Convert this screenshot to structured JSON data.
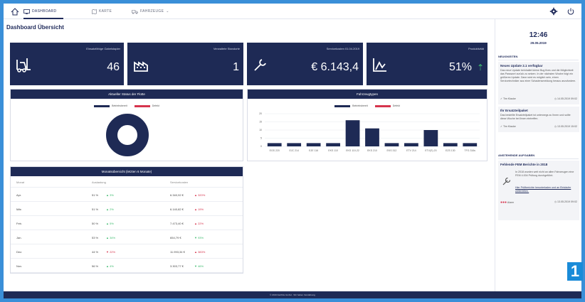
{
  "nav": {
    "dashboard": "DASHBOARD",
    "karte": "KARTE",
    "fahrzeuge": "FAHRZEUGE"
  },
  "page_title": "Dashboard Übersicht",
  "kpis": [
    {
      "label": "Einsatzfähige Gabelstapler",
      "value": "46",
      "icon": "forklift-icon"
    },
    {
      "label": "Verwaltete Standorte",
      "value": "1",
      "icon": "factory-icon"
    },
    {
      "label": "Servicekosten 01.04.2019",
      "value": "€ 6.143,4",
      "icon": "wrench-icon"
    },
    {
      "label": "Produktivität",
      "value": "51%",
      "icon": "chart-icon"
    }
  ],
  "fleet_status": {
    "title": "Aktueller Status der Flotte",
    "legend": [
      "Betriebsbereit",
      "Defekt"
    ],
    "colors": {
      "ok": "#1e2a55",
      "defect": "#d6344d"
    }
  },
  "vehicles": {
    "title": "Fahrzeugtypen",
    "legend": [
      "Betriebsbereit",
      "Defekt"
    ],
    "ytick_labels": [
      "20",
      "15",
      "10",
      "5",
      "0"
    ]
  },
  "chart_data": {
    "type": "bar",
    "categories": [
      "EGS 220",
      "EJC 214",
      "EJE 116",
      "EKS 110",
      "EKS 110-22",
      "EKS 210",
      "EKS 312",
      "ETV 214",
      "ETV(S) 20",
      "EZS 130",
      "TFG 316s"
    ],
    "series": [
      {
        "name": "Betriebsbereit",
        "values": [
          2,
          2,
          2,
          2,
          16,
          11,
          2,
          2,
          10,
          2,
          2
        ]
      },
      {
        "name": "Defekt",
        "values": [
          0,
          0,
          0,
          0,
          0,
          0,
          0,
          0,
          0,
          0,
          0
        ]
      }
    ],
    "ylim": [
      0,
      20
    ]
  },
  "monthly": {
    "title": "Monatsübersicht (letzten 6 Monate)",
    "headers": [
      "Monat",
      "Auslastung",
      "Servicekosten"
    ],
    "rows": [
      {
        "month": "Apr.",
        "load": "51 %",
        "load_delta": "▲ 3%",
        "cost": "6.340,92 €",
        "cost_delta": "▲ 320%"
      },
      {
        "month": "Mär.",
        "load": "51 %",
        "load_delta": "▲ 2%",
        "cost": "6.140,82 €",
        "cost_delta": "▲ 19%"
      },
      {
        "month": "Feb.",
        "load": "50 %",
        "load_delta": "▲ 5%",
        "cost": "7.473,40 €",
        "cost_delta": "▲ 22%"
      },
      {
        "month": "Jan.",
        "load": "53 %",
        "load_delta": "▲ 34%",
        "cost": "654,79 €",
        "cost_delta": "▼ 93%"
      },
      {
        "month": "Dez.",
        "load": "44 %",
        "load_delta": "▼ 22%",
        "cost": "11.993,34 €",
        "cost_delta": "▲ 383%"
      },
      {
        "month": "Nov.",
        "load": "56 %",
        "load_delta": "▲ 4%",
        "cost": "3.303,77 €",
        "cost_delta": "▼ 46%"
      }
    ]
  },
  "sidebar": {
    "time": "12:46",
    "date": "29.05.2019",
    "news_title": "NEUIGKEITEN",
    "news": [
      {
        "title": "Neues Update 2.1 verfügbar",
        "body": "Das neue Update beinhaltet kleine Bug fixes und die Möglichkeit das Passwort zurück zu setzen. In der nächsten Woche folgt ein größeres Update. Dann wird es möglich sein, einen Servicetechniker aus einer Schadensmeldung heraus anzufordern.",
        "author": "Tim Klauke",
        "date": "14.05.2019 09:02"
      },
      {
        "title": "Ihr Ersatzteilpaket",
        "body": "Das bestellte Ersatzteilpaket ist unterwegs zu Ihnen und sollte diese Woche bei Ihnen eintreffen.",
        "author": "Tim Klauke",
        "date": "13.05.2019 15:02"
      }
    ],
    "tasks_title": "ANSTEHENDE AUFGABEN",
    "task": {
      "title": "Fehlende FEM Berichte in 2018",
      "body": "In 2018 wurden weit nicht an allen Fahrzeugen eine FEM 4.004 Prüfung durchgeführt.",
      "link": "Hier Prüfberichte herunterladen und an Einkäufer weiterleiten.",
      "tag": "Alarm",
      "date": "13.05.2019 09:02"
    }
  },
  "footer": "© 2019 Fachhle GmbH · Wir haben Verstärkung",
  "badge": "1"
}
